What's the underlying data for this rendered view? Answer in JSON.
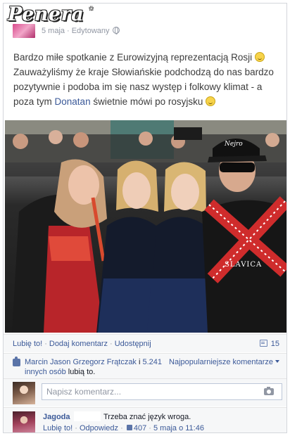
{
  "page": {
    "name": "Penera",
    "date": "5 maja",
    "edited": "Edytowany"
  },
  "post": {
    "text_part1": "Bardzo miłe spotkanie z Eurowizyjną reprezentacją Rosji ",
    "text_part2": " Zauważyliśmy że kraje Słowiańskie podchodzą do nas bardzo pozytywnie i podoba im się nasz występ i folkowy klimat - a poza tym ",
    "mention": "Donatan",
    "text_part3": " świetnie mówi po rosyjsku ",
    "smile_icon": "smile-emoticon"
  },
  "photo": {
    "hat_text": "Nejro",
    "shirt_text": "SLAVICA"
  },
  "actions": {
    "like": "Lubię to!",
    "comment": "Dodaj komentarz",
    "share": "Udostępnij",
    "share_count": "15",
    "separator": "·"
  },
  "likes": {
    "text": "Marcin Jason Grzegorz Frątczak i 5.241 innych osób lubią to.",
    "names": "Marcin Jason Grzegorz Frątczak",
    "connector": " i ",
    "others": "5.241 innych osób",
    "suffix": " lubią to.",
    "sort_label": "Najpopularniejsze komentarze"
  },
  "compose": {
    "placeholder": "Napisz komentarz..."
  },
  "comment": {
    "author": "Jagoda",
    "text": "Trzeba znać język wroga.",
    "like": "Lubię to!",
    "reply": "Odpowiedz",
    "like_count": "407",
    "timestamp": "5 maja o 11:46",
    "separator": "·"
  },
  "colors": {
    "link": "#3b5998",
    "muted": "#9197a3",
    "bar_bg": "#f6f7f8"
  }
}
